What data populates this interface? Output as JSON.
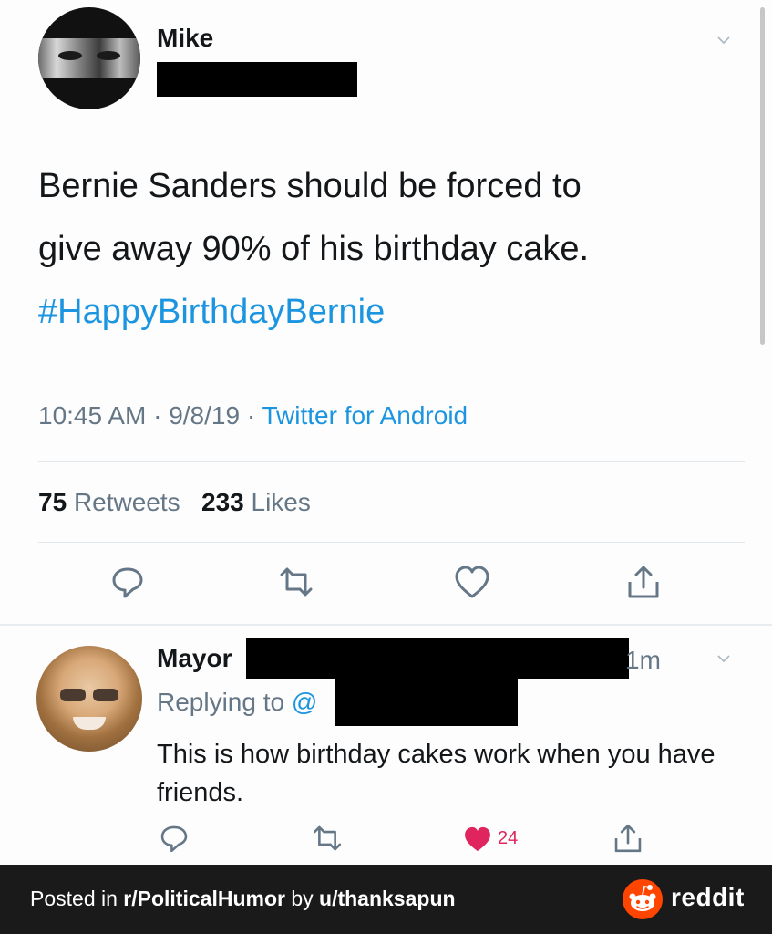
{
  "tweet": {
    "author_name": "Mike",
    "text_line1": "Bernie Sanders should be forced to",
    "text_line2": "give away 90% of his birthday cake.",
    "hashtag": "#HappyBirthdayBernie",
    "time": "10:45 AM",
    "date": "9/8/19",
    "separator": "·",
    "source": "Twitter for Android",
    "retweets_count": "75",
    "retweets_label": "Retweets",
    "likes_count": "233",
    "likes_label": "Likes",
    "icons": [
      "reply-icon",
      "retweet-icon",
      "like-icon",
      "share-icon",
      "chevron-down-icon"
    ]
  },
  "reply": {
    "author_name": "Mayor",
    "time": "1m",
    "replying_prefix": "Replying to",
    "replying_at": "@",
    "text": "This is how birthday cakes work when you have friends.",
    "like_count": "24",
    "icons": [
      "reply-icon",
      "retweet-icon",
      "liked-heart-icon",
      "share-icon",
      "chevron-down-icon"
    ]
  },
  "footer": {
    "posted_in": "Posted in",
    "subreddit": "r/PoliticalHumor",
    "by": "by",
    "username": "u/thanksapun",
    "brand": "reddit",
    "brand_icon": "reddit-snoo-icon"
  },
  "colors": {
    "link_blue": "#1b95e0",
    "muted_gray": "#657786",
    "like_pink": "#e0245e",
    "reddit_orange": "#ff4500",
    "footer_bg": "#1a1a1b"
  }
}
